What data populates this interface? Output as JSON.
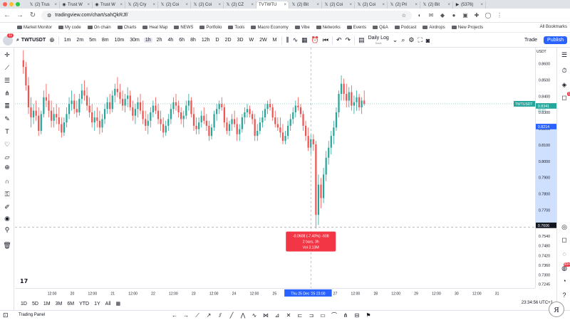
{
  "browser": {
    "tabs": [
      {
        "favicon": "x-logo-icon",
        "glyph": "𝕏",
        "label": "(2) Trus"
      },
      {
        "favicon": "shield-icon",
        "glyph": "◉",
        "label": "Trust W"
      },
      {
        "favicon": "shield-icon",
        "glyph": "◉",
        "label": "Trust W"
      },
      {
        "favicon": "x-logo-icon",
        "glyph": "𝕏",
        "label": "(2) Cry"
      },
      {
        "favicon": "x-logo-icon",
        "glyph": "𝕏",
        "label": "(2) Coi"
      },
      {
        "favicon": "x-logo-icon",
        "glyph": "𝕏",
        "label": "(2) Coi"
      },
      {
        "favicon": "x-logo-icon",
        "glyph": "𝕏",
        "label": "(2) CZ"
      },
      {
        "favicon": "tradingview-icon",
        "glyph": "TV",
        "label": "TWTU",
        "active": true
      },
      {
        "favicon": "x-logo-icon",
        "glyph": "𝕏",
        "label": "(2) Bit"
      },
      {
        "favicon": "x-logo-icon",
        "glyph": "𝕏",
        "label": "(2) Coi"
      },
      {
        "favicon": "x-logo-icon",
        "glyph": "𝕏",
        "label": "(2) Coi"
      },
      {
        "favicon": "x-logo-icon",
        "glyph": "𝕏",
        "label": "(2) Pri"
      },
      {
        "favicon": "x-logo-icon",
        "glyph": "𝕏",
        "label": "(2) Bit"
      },
      {
        "favicon": "youtube-icon",
        "glyph": "▶",
        "label": "(5376)"
      }
    ],
    "url": "tradingview.com/chart/sahQkRJf/",
    "bookmarks": [
      "Market Monitor",
      "My code",
      "On chain",
      "Charts",
      "Heat Map",
      "NEWS",
      "Portfolio",
      "Tools",
      "Macro Economy",
      "Vibe",
      "Networks",
      "Events",
      "Q&A",
      "Podcast",
      "Airdrops",
      "New Projects"
    ],
    "all_bookmarks": "All Bookmarks"
  },
  "toolbar": {
    "notification_count": "11",
    "symbol": "TWTUSDT",
    "intervals": [
      "1m",
      "2m",
      "5m",
      "8m",
      "10m",
      "30m",
      "1h",
      "2h",
      "4h",
      "6h",
      "8h",
      "12h",
      "D",
      "2D",
      "3D",
      "W",
      "2W",
      "M"
    ],
    "selected_interval": "1h",
    "layout_name": "Daily Log",
    "layout_sub": "Save",
    "trade_label": "Trade",
    "publish_label": "Publish"
  },
  "chart_data": {
    "type": "candlestick",
    "symbol": "TWTUSDT",
    "currency": "USDT",
    "interval": "1h",
    "ylim": [
      0.7245,
      0.8675
    ],
    "price_ticks": [
      "0.8600",
      "0.8500",
      "0.8400",
      "0.8300",
      "0.8200",
      "0.8100",
      "0.8000",
      "0.7900",
      "0.7800",
      "0.7700",
      "0.7600",
      "0.7540",
      "0.7480",
      "0.7420",
      "0.7360",
      "0.7300",
      "0.7245"
    ],
    "time_ticks": [
      "12:00",
      "20",
      "12:00",
      "21",
      "12:00",
      "22",
      "12:00",
      "23",
      "12:00",
      "24",
      "12:00",
      "25",
      "",
      "00",
      "27",
      "12:00",
      "28",
      "12:00",
      "29",
      "12:00",
      "30",
      "12:00",
      "31"
    ],
    "last_price_label": {
      "symbol": "TWTUSDT",
      "price": "0.8341",
      "countdown": "25:03"
    },
    "highlight_price": "0.8214",
    "crosshair_price": "0.7606",
    "crosshair_time": "Thu 25 Dec '25  23:00",
    "measure": {
      "line1": "-0.0608 (-7.40%) -608",
      "line2": "2 bars, 3h",
      "line3": "Vol 3.13M"
    },
    "candles": [
      [
        0.86,
        0.866,
        0.852,
        0.856
      ],
      [
        0.856,
        0.859,
        0.842,
        0.845
      ],
      [
        0.845,
        0.85,
        0.828,
        0.832
      ],
      [
        0.832,
        0.838,
        0.82,
        0.826
      ],
      [
        0.826,
        0.834,
        0.822,
        0.83
      ],
      [
        0.83,
        0.836,
        0.824,
        0.827
      ],
      [
        0.827,
        0.832,
        0.815,
        0.818
      ],
      [
        0.818,
        0.83,
        0.816,
        0.828
      ],
      [
        0.828,
        0.842,
        0.826,
        0.838
      ],
      [
        0.838,
        0.846,
        0.832,
        0.836
      ],
      [
        0.836,
        0.84,
        0.826,
        0.83
      ],
      [
        0.83,
        0.836,
        0.82,
        0.824
      ],
      [
        0.824,
        0.832,
        0.82,
        0.828
      ],
      [
        0.828,
        0.834,
        0.822,
        0.826
      ],
      [
        0.826,
        0.832,
        0.818,
        0.822
      ],
      [
        0.822,
        0.826,
        0.814,
        0.817
      ],
      [
        0.817,
        0.826,
        0.815,
        0.823
      ],
      [
        0.823,
        0.832,
        0.82,
        0.828
      ],
      [
        0.828,
        0.838,
        0.825,
        0.834
      ],
      [
        0.834,
        0.842,
        0.83,
        0.836
      ],
      [
        0.836,
        0.84,
        0.828,
        0.831
      ],
      [
        0.831,
        0.836,
        0.826,
        0.829
      ],
      [
        0.829,
        0.84,
        0.827,
        0.837
      ],
      [
        0.837,
        0.846,
        0.834,
        0.842
      ],
      [
        0.842,
        0.848,
        0.836,
        0.839
      ],
      [
        0.839,
        0.844,
        0.83,
        0.833
      ],
      [
        0.833,
        0.838,
        0.826,
        0.829
      ],
      [
        0.829,
        0.834,
        0.82,
        0.823
      ],
      [
        0.823,
        0.83,
        0.818,
        0.826
      ],
      [
        0.826,
        0.832,
        0.82,
        0.824
      ],
      [
        0.824,
        0.83,
        0.816,
        0.82
      ],
      [
        0.82,
        0.828,
        0.817,
        0.825
      ],
      [
        0.825,
        0.834,
        0.822,
        0.831
      ],
      [
        0.831,
        0.838,
        0.828,
        0.835
      ],
      [
        0.835,
        0.84,
        0.828,
        0.831
      ],
      [
        0.831,
        0.842,
        0.829,
        0.839
      ],
      [
        0.839,
        0.846,
        0.835,
        0.843
      ],
      [
        0.843,
        0.85,
        0.838,
        0.841
      ],
      [
        0.841,
        0.846,
        0.834,
        0.837
      ],
      [
        0.837,
        0.842,
        0.83,
        0.833
      ],
      [
        0.833,
        0.84,
        0.829,
        0.837
      ],
      [
        0.837,
        0.844,
        0.832,
        0.839
      ],
      [
        0.839,
        0.842,
        0.83,
        0.832
      ],
      [
        0.832,
        0.836,
        0.824,
        0.827
      ],
      [
        0.827,
        0.834,
        0.822,
        0.831
      ],
      [
        0.831,
        0.838,
        0.826,
        0.835
      ],
      [
        0.835,
        0.84,
        0.828,
        0.83
      ],
      [
        0.83,
        0.836,
        0.822,
        0.825
      ],
      [
        0.825,
        0.83,
        0.818,
        0.821
      ],
      [
        0.821,
        0.828,
        0.816,
        0.824
      ],
      [
        0.824,
        0.832,
        0.82,
        0.829
      ],
      [
        0.829,
        0.836,
        0.826,
        0.833
      ],
      [
        0.833,
        0.838,
        0.828,
        0.83
      ],
      [
        0.83,
        0.834,
        0.822,
        0.825
      ],
      [
        0.825,
        0.83,
        0.818,
        0.822
      ],
      [
        0.822,
        0.826,
        0.814,
        0.817
      ],
      [
        0.817,
        0.824,
        0.815,
        0.821
      ],
      [
        0.821,
        0.828,
        0.818,
        0.825
      ],
      [
        0.825,
        0.834,
        0.822,
        0.831
      ],
      [
        0.831,
        0.838,
        0.828,
        0.835
      ],
      [
        0.835,
        0.84,
        0.83,
        0.833
      ],
      [
        0.833,
        0.836,
        0.826,
        0.829
      ],
      [
        0.829,
        0.832,
        0.822,
        0.825
      ],
      [
        0.825,
        0.83,
        0.82,
        0.827
      ],
      [
        0.827,
        0.836,
        0.825,
        0.833
      ],
      [
        0.833,
        0.84,
        0.83,
        0.836
      ],
      [
        0.836,
        0.838,
        0.826,
        0.828
      ],
      [
        0.828,
        0.832,
        0.818,
        0.821
      ],
      [
        0.821,
        0.826,
        0.816,
        0.819
      ],
      [
        0.819,
        0.826,
        0.816,
        0.823
      ],
      [
        0.823,
        0.83,
        0.82,
        0.827
      ],
      [
        0.827,
        0.832,
        0.822,
        0.824
      ],
      [
        0.824,
        0.828,
        0.818,
        0.821
      ],
      [
        0.821,
        0.824,
        0.812,
        0.815
      ],
      [
        0.815,
        0.822,
        0.813,
        0.82
      ],
      [
        0.82,
        0.83,
        0.818,
        0.828
      ],
      [
        0.828,
        0.834,
        0.824,
        0.831
      ],
      [
        0.831,
        0.836,
        0.828,
        0.834
      ],
      [
        0.834,
        0.838,
        0.83,
        0.832
      ],
      [
        0.832,
        0.834,
        0.82,
        0.823
      ],
      [
        0.823,
        0.826,
        0.816,
        0.818
      ],
      [
        0.818,
        0.824,
        0.815,
        0.822
      ],
      [
        0.822,
        0.828,
        0.818,
        0.825
      ],
      [
        0.825,
        0.83,
        0.82,
        0.822
      ],
      [
        0.822,
        0.826,
        0.812,
        0.816
      ],
      [
        0.816,
        0.822,
        0.812,
        0.819
      ],
      [
        0.819,
        0.828,
        0.817,
        0.826
      ],
      [
        0.826,
        0.832,
        0.822,
        0.829
      ],
      [
        0.829,
        0.834,
        0.826,
        0.831
      ],
      [
        0.831,
        0.833,
        0.826,
        0.828
      ],
      [
        0.828,
        0.83,
        0.822,
        0.825
      ],
      [
        0.825,
        0.828,
        0.812,
        0.815
      ],
      [
        0.815,
        0.822,
        0.812,
        0.818
      ],
      [
        0.818,
        0.826,
        0.816,
        0.823
      ],
      [
        0.823,
        0.83,
        0.82,
        0.826
      ],
      [
        0.826,
        0.834,
        0.824,
        0.831
      ],
      [
        0.831,
        0.836,
        0.828,
        0.834
      ],
      [
        0.834,
        0.837,
        0.83,
        0.832
      ],
      [
        0.832,
        0.834,
        0.824,
        0.826
      ],
      [
        0.826,
        0.83,
        0.82,
        0.822
      ],
      [
        0.822,
        0.826,
        0.818,
        0.82
      ],
      [
        0.82,
        0.826,
        0.814,
        0.817
      ],
      [
        0.817,
        0.822,
        0.81,
        0.812
      ],
      [
        0.812,
        0.818,
        0.81,
        0.815
      ],
      [
        0.815,
        0.824,
        0.813,
        0.821
      ],
      [
        0.821,
        0.828,
        0.818,
        0.825
      ],
      [
        0.825,
        0.832,
        0.822,
        0.829
      ],
      [
        0.829,
        0.836,
        0.826,
        0.833
      ],
      [
        0.833,
        0.838,
        0.83,
        0.832
      ],
      [
        0.832,
        0.834,
        0.826,
        0.828
      ],
      [
        0.828,
        0.83,
        0.818,
        0.821
      ],
      [
        0.821,
        0.824,
        0.812,
        0.815
      ],
      [
        0.815,
        0.82,
        0.806,
        0.808
      ],
      [
        0.808,
        0.816,
        0.804,
        0.813
      ],
      [
        0.813,
        0.816,
        0.806,
        0.81
      ],
      [
        0.81,
        0.812,
        0.76,
        0.768
      ],
      [
        0.768,
        0.792,
        0.762,
        0.786
      ],
      [
        0.786,
        0.79,
        0.772,
        0.778
      ],
      [
        0.778,
        0.796,
        0.775,
        0.792
      ],
      [
        0.792,
        0.806,
        0.788,
        0.802
      ],
      [
        0.802,
        0.812,
        0.798,
        0.808
      ],
      [
        0.808,
        0.818,
        0.804,
        0.815
      ],
      [
        0.815,
        0.824,
        0.81,
        0.82
      ],
      [
        0.82,
        0.832,
        0.818,
        0.829
      ],
      [
        0.829,
        0.842,
        0.826,
        0.84
      ],
      [
        0.84,
        0.851,
        0.836,
        0.846
      ],
      [
        0.846,
        0.849,
        0.836,
        0.84
      ],
      [
        0.84,
        0.846,
        0.832,
        0.836
      ],
      [
        0.836,
        0.844,
        0.832,
        0.841
      ],
      [
        0.841,
        0.845,
        0.83,
        0.833
      ],
      [
        0.833,
        0.839,
        0.828,
        0.835
      ],
      [
        0.835,
        0.842,
        0.83,
        0.838
      ],
      [
        0.838,
        0.84,
        0.83,
        0.832
      ],
      [
        0.832,
        0.838,
        0.828,
        0.836
      ],
      [
        0.836,
        0.842,
        0.833,
        0.834
      ]
    ]
  },
  "bottom": {
    "ranges": [
      "1D",
      "5D",
      "1M",
      "3M",
      "6M",
      "YTD",
      "1Y",
      "All"
    ],
    "clock": "23:34:56 UTC+1",
    "panel": "Trading Panel"
  },
  "colors": {
    "up": "#26a69a",
    "down": "#ef5350",
    "accent": "#2962ff",
    "crosshair": "#9598a1",
    "measure_bg": "#f23645",
    "highlight_band": "#cfe0ff"
  }
}
